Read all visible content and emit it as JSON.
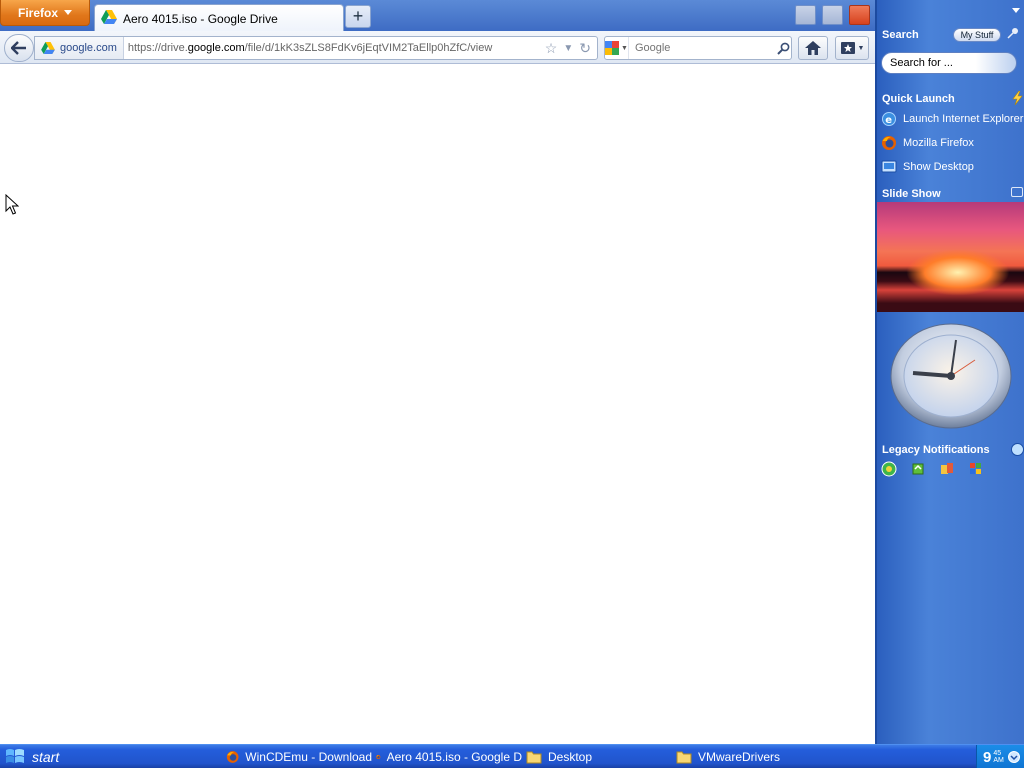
{
  "firefox": {
    "menu_button_label": "Firefox",
    "tab": {
      "title": "Aero 4015.iso - Google Drive",
      "favicon": "google-drive-icon"
    },
    "new_tab_label": "+",
    "url": {
      "identity": "google.com",
      "prefix": "https://drive.",
      "host": "google.com",
      "path": "/file/d/1kK3sZLS8FdKv6jEqtVIM2TaEllp0hZfC/view"
    },
    "search": {
      "placeholder": "Google",
      "engine_icon": "google-icon"
    }
  },
  "sidebar": {
    "search_header": "Search",
    "my_stuff_label": "My Stuff",
    "search_placeholder": "Search for ...",
    "quick_launch": {
      "header": "Quick Launch",
      "items": [
        {
          "label": "Launch Internet Explorer",
          "icon": "internet-explorer-icon"
        },
        {
          "label": "Mozilla Firefox",
          "icon": "firefox-icon"
        },
        {
          "label": "Show Desktop",
          "icon": "show-desktop-icon"
        }
      ]
    },
    "slideshow_header": "Slide Show",
    "legacy_header": "Legacy Notifications",
    "legacy_icons": [
      "network-icon",
      "update-icon",
      "security-icon",
      "windows-flag-icon"
    ]
  },
  "taskbar": {
    "start_label": "start",
    "tasks": [
      {
        "label": "WinCDEmu - Download",
        "icon": "firefox-icon"
      },
      {
        "label": "Aero 4015.iso - Google D",
        "icon": "firefox-icon"
      },
      {
        "label": "Desktop",
        "icon": "folder-icon"
      },
      {
        "label": "VMwareDrivers",
        "icon": "folder-icon"
      }
    ],
    "clock": {
      "hour": "9",
      "minute": "45",
      "ampm": "AM"
    }
  },
  "colors": {
    "taskbar_blue": "#245edb",
    "sidebar_blue": "#3e72cc",
    "firefox_orange": "#e1771b",
    "close_red": "#d6421e"
  }
}
